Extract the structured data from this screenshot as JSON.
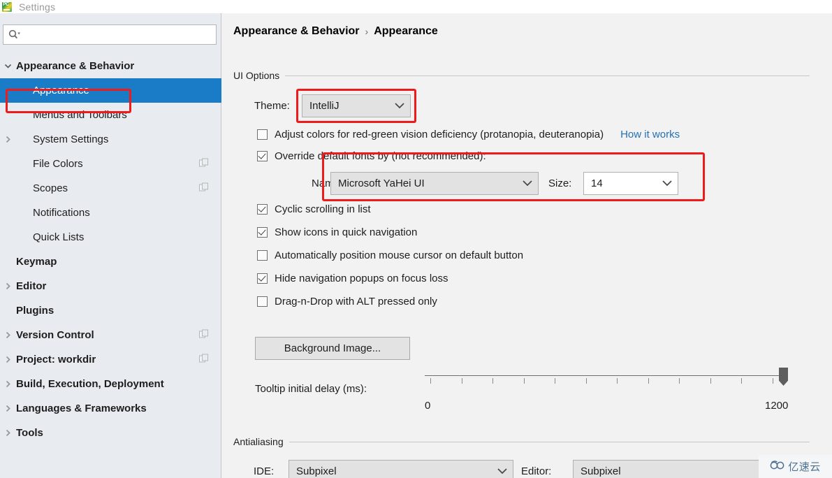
{
  "window": {
    "title": "Settings",
    "app_icon": "pycharm-icon"
  },
  "sidebar": {
    "search": {
      "value": "",
      "placeholder": "",
      "icon": "search-icon"
    },
    "items": [
      {
        "label": "Appearance & Behavior",
        "indent": 0,
        "bold": true,
        "arrow": "down",
        "selected": false,
        "badge": false
      },
      {
        "label": "Appearance",
        "indent": 1,
        "bold": false,
        "arrow": "none",
        "selected": true,
        "badge": false
      },
      {
        "label": "Menus and Toolbars",
        "indent": 1,
        "bold": false,
        "arrow": "none",
        "selected": false,
        "badge": false
      },
      {
        "label": "System Settings",
        "indent": 1,
        "bold": false,
        "arrow": "right",
        "selected": false,
        "badge": false
      },
      {
        "label": "File Colors",
        "indent": 1,
        "bold": false,
        "arrow": "none",
        "selected": false,
        "badge": true
      },
      {
        "label": "Scopes",
        "indent": 1,
        "bold": false,
        "arrow": "none",
        "selected": false,
        "badge": true
      },
      {
        "label": "Notifications",
        "indent": 1,
        "bold": false,
        "arrow": "none",
        "selected": false,
        "badge": false
      },
      {
        "label": "Quick Lists",
        "indent": 1,
        "bold": false,
        "arrow": "none",
        "selected": false,
        "badge": false
      },
      {
        "label": "Keymap",
        "indent": 0,
        "bold": true,
        "arrow": "none",
        "selected": false,
        "badge": false
      },
      {
        "label": "Editor",
        "indent": 0,
        "bold": true,
        "arrow": "right",
        "selected": false,
        "badge": false
      },
      {
        "label": "Plugins",
        "indent": 0,
        "bold": true,
        "arrow": "none",
        "selected": false,
        "badge": false
      },
      {
        "label": "Version Control",
        "indent": 0,
        "bold": true,
        "arrow": "right",
        "selected": false,
        "badge": true
      },
      {
        "label": "Project: workdir",
        "indent": 0,
        "bold": true,
        "arrow": "right",
        "selected": false,
        "badge": true
      },
      {
        "label": "Build, Execution, Deployment",
        "indent": 0,
        "bold": true,
        "arrow": "right",
        "selected": false,
        "badge": false
      },
      {
        "label": "Languages & Frameworks",
        "indent": 0,
        "bold": true,
        "arrow": "right",
        "selected": false,
        "badge": false
      },
      {
        "label": "Tools",
        "indent": 0,
        "bold": true,
        "arrow": "right",
        "selected": false,
        "badge": false
      }
    ]
  },
  "breadcrumb": {
    "root": "Appearance & Behavior",
    "separator": "›",
    "current": "Appearance"
  },
  "ui_options": {
    "group_title": "UI Options",
    "theme_label": "Theme:",
    "theme_value": "IntelliJ",
    "colorblind_label": "Adjust colors for red-green vision deficiency (protanopia, deuteranopia)",
    "colorblind_checked": false,
    "how_it_works_link": "How it works",
    "override_fonts_label": "Override default fonts by (not recommended):",
    "override_fonts_checked": true,
    "font_name_label": "Name:",
    "font_name_value": "Microsoft YaHei UI",
    "font_size_label": "Size:",
    "font_size_value": "14",
    "checkboxes": [
      {
        "label": "Cyclic scrolling in list",
        "checked": true
      },
      {
        "label": "Show icons in quick navigation",
        "checked": true
      },
      {
        "label": "Automatically position mouse cursor on default button",
        "checked": false
      },
      {
        "label": "Hide navigation popups on focus loss",
        "checked": true
      },
      {
        "label": "Drag-n-Drop with ALT pressed only",
        "checked": false
      }
    ],
    "background_image_button": "Background Image...",
    "tooltip_delay_label": "Tooltip initial delay (ms):",
    "tooltip_delay_min": "0",
    "tooltip_delay_max": "1200",
    "tooltip_delay_value": 1200,
    "tooltip_tick_count": 12
  },
  "antialiasing": {
    "group_title": "Antialiasing",
    "ide_label": "IDE:",
    "ide_value": "Subpixel",
    "editor_label": "Editor:",
    "editor_value": "Subpixel"
  },
  "annotations": {
    "highlight_color": "#ef1b1b",
    "boxes": [
      {
        "name": "appearance-sidebar-highlight"
      },
      {
        "name": "theme-combo-highlight"
      },
      {
        "name": "font-name-size-highlight"
      }
    ]
  },
  "watermark": {
    "text": "亿速云",
    "icon": "cloud-logo-icon"
  }
}
